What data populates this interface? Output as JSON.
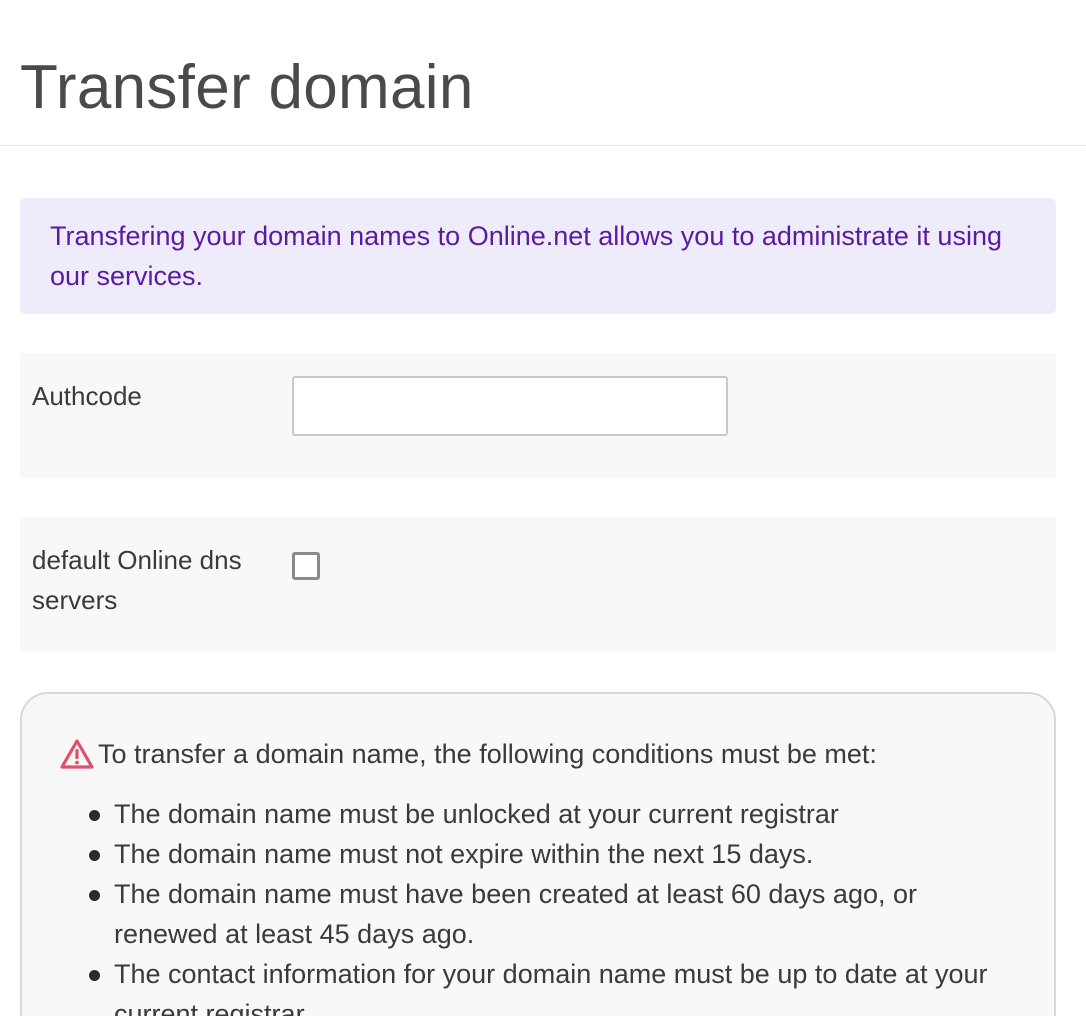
{
  "page": {
    "title": "Transfer domain"
  },
  "info": {
    "text": "Transfering your domain names to Online.net allows you to administrate it using our services."
  },
  "form": {
    "authcode": {
      "label": "Authcode",
      "value": "",
      "placeholder": ""
    },
    "default_dns": {
      "label": "default Online dns servers",
      "checked": false
    }
  },
  "conditions": {
    "icon": "warning-icon",
    "heading": "To transfer a domain name, the following conditions must be met:",
    "items": [
      "The domain name must be unlocked at your current registrar",
      "The domain name must not expire within the next 15 days.",
      "The domain name must have been created at least 60 days ago, or renewed at least 45 days ago.",
      "The contact information for your domain name must be up to date at your current registrar."
    ]
  },
  "colors": {
    "info_background": "#eeebfb",
    "info_text": "#5b1aa0",
    "warning_icon": "#e0506a"
  }
}
